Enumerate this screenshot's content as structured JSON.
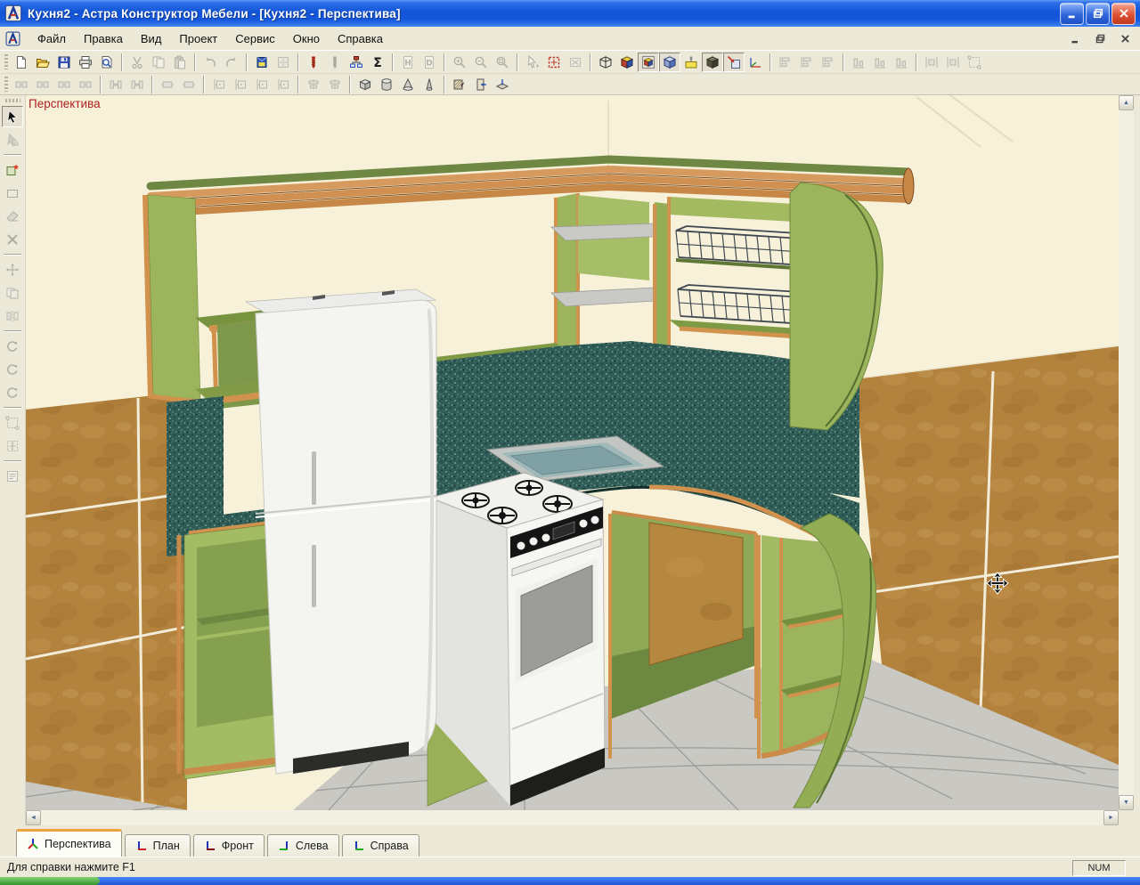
{
  "window": {
    "title": "Кухня2 - Астра Конструктор Мебели - [Кухня2 - Перспектива]",
    "controls": [
      "minimize",
      "restore",
      "close"
    ],
    "mdi_controls": [
      "minimize",
      "restore",
      "close"
    ]
  },
  "menu": {
    "items": [
      "Файл",
      "Правка",
      "Вид",
      "Проект",
      "Сервис",
      "Окно",
      "Справка"
    ]
  },
  "toolbar_main": {
    "groups": [
      {
        "buttons": [
          {
            "name": "new",
            "icon": "new",
            "enabled": true,
            "pressed": false
          },
          {
            "name": "open",
            "icon": "open",
            "enabled": true,
            "pressed": false
          },
          {
            "name": "save",
            "icon": "save",
            "enabled": true,
            "pressed": false
          },
          {
            "name": "print",
            "icon": "print",
            "enabled": true,
            "pressed": false
          },
          {
            "name": "print-preview",
            "icon": "preview",
            "enabled": true,
            "pressed": false
          }
        ]
      },
      {
        "buttons": [
          {
            "name": "cut",
            "icon": "cut",
            "enabled": false,
            "pressed": false
          },
          {
            "name": "copy",
            "icon": "copy",
            "enabled": false,
            "pressed": false
          },
          {
            "name": "paste",
            "icon": "paste",
            "enabled": false,
            "pressed": false
          }
        ]
      },
      {
        "buttons": [
          {
            "name": "undo",
            "icon": "undo",
            "enabled": false,
            "pressed": false
          },
          {
            "name": "redo",
            "icon": "redo",
            "enabled": false,
            "pressed": false
          }
        ]
      },
      {
        "buttons": [
          {
            "name": "materials",
            "icon": "material",
            "enabled": true,
            "pressed": false
          },
          {
            "name": "textures",
            "icon": "texture",
            "enabled": false,
            "pressed": false
          }
        ]
      },
      {
        "buttons": [
          {
            "name": "fasteners",
            "icon": "screw",
            "enabled": true,
            "pressed": false
          },
          {
            "name": "fasteners-auto",
            "icon": "screw",
            "enabled": false,
            "pressed": false
          },
          {
            "name": "structure",
            "icon": "tree",
            "enabled": true,
            "pressed": false
          },
          {
            "name": "calculate",
            "icon": "sigma",
            "enabled": true,
            "pressed": false
          }
        ]
      },
      {
        "buttons": [
          {
            "name": "spec-h",
            "icon": "doc-h",
            "enabled": false,
            "pressed": false
          },
          {
            "name": "spec-d",
            "icon": "doc-d",
            "enabled": false,
            "pressed": false
          }
        ]
      },
      {
        "buttons": [
          {
            "name": "zoom-in",
            "icon": "zoom-in",
            "enabled": false,
            "pressed": false
          },
          {
            "name": "zoom-out",
            "icon": "zoom-out",
            "enabled": false,
            "pressed": false
          },
          {
            "name": "zoom-extents",
            "icon": "zoom-ext",
            "enabled": false,
            "pressed": false
          }
        ]
      },
      {
        "buttons": [
          {
            "name": "zoom-window",
            "icon": "pointer-zoom",
            "enabled": false,
            "pressed": false
          },
          {
            "name": "zoom-selection",
            "icon": "fit-red",
            "enabled": true,
            "pressed": false
          },
          {
            "name": "erase-region",
            "icon": "xbox",
            "enabled": false,
            "pressed": false
          }
        ]
      },
      {
        "buttons": [
          {
            "name": "view-wireframe",
            "icon": "cube-wire",
            "enabled": true,
            "pressed": false
          },
          {
            "name": "view-shaded",
            "icon": "cube-solid",
            "enabled": true,
            "pressed": false
          },
          {
            "name": "view-edges",
            "icon": "cube-frame",
            "enabled": true,
            "pressed": true
          },
          {
            "name": "view-frame",
            "icon": "cube-blue",
            "enabled": true,
            "pressed": true
          },
          {
            "name": "view-fittings",
            "icon": "screw-box",
            "enabled": true,
            "pressed": false
          },
          {
            "name": "view-textured",
            "icon": "cube-dark",
            "enabled": true,
            "pressed": true
          },
          {
            "name": "move-object",
            "icon": "move-obj",
            "enabled": true,
            "pressed": true
          },
          {
            "name": "show-axes",
            "icon": "axes",
            "enabled": true,
            "pressed": false
          }
        ]
      },
      {
        "buttons": [
          {
            "name": "align-left",
            "icon": "align-h",
            "enabled": false,
            "pressed": false
          },
          {
            "name": "align-center-h",
            "icon": "align-h",
            "enabled": false,
            "pressed": false
          },
          {
            "name": "align-right",
            "icon": "align-h",
            "enabled": false,
            "pressed": false
          }
        ]
      },
      {
        "buttons": [
          {
            "name": "align-top",
            "icon": "align-v",
            "enabled": false,
            "pressed": false
          },
          {
            "name": "align-center-v",
            "icon": "align-v",
            "enabled": false,
            "pressed": false
          },
          {
            "name": "align-bottom",
            "icon": "align-v",
            "enabled": false,
            "pressed": false
          }
        ]
      },
      {
        "buttons": [
          {
            "name": "distribute-h",
            "icon": "distribute",
            "enabled": false,
            "pressed": false
          },
          {
            "name": "distribute-v",
            "icon": "distribute",
            "enabled": false,
            "pressed": false
          },
          {
            "name": "fit-frame",
            "icon": "selframe",
            "enabled": false,
            "pressed": false
          }
        ]
      }
    ]
  },
  "toolbar_second": {
    "groups": [
      {
        "buttons": [
          {
            "name": "bind-left",
            "icon": "bind",
            "enabled": false,
            "pressed": false
          },
          {
            "name": "bind-top",
            "icon": "bind",
            "enabled": false,
            "pressed": false
          },
          {
            "name": "bind-right",
            "icon": "bind",
            "enabled": false,
            "pressed": false
          },
          {
            "name": "bind-bottom",
            "icon": "bind",
            "enabled": false,
            "pressed": false
          }
        ]
      },
      {
        "buttons": [
          {
            "name": "gap-horizontal",
            "icon": "gap",
            "enabled": false,
            "pressed": false
          },
          {
            "name": "gap-vertical",
            "icon": "gap",
            "enabled": false,
            "pressed": false
          }
        ]
      },
      {
        "buttons": [
          {
            "name": "equal-width",
            "icon": "size",
            "enabled": false,
            "pressed": false
          },
          {
            "name": "equal-height",
            "icon": "size",
            "enabled": false,
            "pressed": false
          }
        ]
      },
      {
        "buttons": [
          {
            "name": "fasten-edge-1",
            "icon": "fasten",
            "enabled": false,
            "pressed": false
          },
          {
            "name": "fasten-edge-2",
            "icon": "fasten",
            "enabled": false,
            "pressed": false
          },
          {
            "name": "fasten-edge-3",
            "icon": "fasten",
            "enabled": false,
            "pressed": false
          },
          {
            "name": "fasten-edge-4",
            "icon": "fasten",
            "enabled": false,
            "pressed": false
          }
        ]
      },
      {
        "buttons": [
          {
            "name": "center-h",
            "icon": "centeralign",
            "enabled": false,
            "pressed": false
          },
          {
            "name": "center-v",
            "icon": "centeralign",
            "enabled": false,
            "pressed": false
          }
        ]
      },
      {
        "buttons": [
          {
            "name": "primitive-box",
            "icon": "prim-box",
            "enabled": true,
            "pressed": false
          },
          {
            "name": "primitive-cylinder",
            "icon": "prim-cyl",
            "enabled": true,
            "pressed": false
          },
          {
            "name": "primitive-cone",
            "icon": "prim-cone",
            "enabled": true,
            "pressed": false
          },
          {
            "name": "primitive-pyramid",
            "icon": "prim-pyr",
            "enabled": true,
            "pressed": false
          }
        ]
      },
      {
        "buttons": [
          {
            "name": "wall",
            "icon": "wall",
            "enabled": true,
            "pressed": false
          },
          {
            "name": "door",
            "icon": "door",
            "enabled": true,
            "pressed": false
          },
          {
            "name": "floor",
            "icon": "floor",
            "enabled": true,
            "pressed": false
          }
        ]
      }
    ]
  },
  "tool_palette": {
    "groups": [
      {
        "buttons": [
          {
            "name": "select",
            "icon": "arrow",
            "enabled": true,
            "pressed": true
          },
          {
            "name": "edit-points",
            "icon": "arrow-plus",
            "enabled": false,
            "pressed": false
          }
        ]
      },
      {
        "buttons": [
          {
            "name": "new-panel",
            "icon": "panel-new",
            "enabled": true,
            "pressed": false
          },
          {
            "name": "draw-rect",
            "icon": "rect",
            "enabled": false,
            "pressed": false
          },
          {
            "name": "erase",
            "icon": "eraser",
            "enabled": false,
            "pressed": false
          },
          {
            "name": "delete",
            "icon": "xdel",
            "enabled": false,
            "pressed": false
          }
        ]
      },
      {
        "buttons": [
          {
            "name": "move",
            "icon": "movetool",
            "enabled": false,
            "pressed": false
          },
          {
            "name": "copy-move",
            "icon": "shelfcopy",
            "enabled": false,
            "pressed": false
          },
          {
            "name": "mirror",
            "icon": "mirror",
            "enabled": false,
            "pressed": false
          }
        ]
      },
      {
        "buttons": [
          {
            "name": "rotate-x",
            "icon": "rotate",
            "enabled": false,
            "pressed": false
          },
          {
            "name": "rotate-y",
            "icon": "rotate",
            "enabled": false,
            "pressed": false
          },
          {
            "name": "rotate-z",
            "icon": "rotate",
            "enabled": false,
            "pressed": false
          }
        ]
      },
      {
        "buttons": [
          {
            "name": "select-frame",
            "icon": "selframe",
            "enabled": false,
            "pressed": false
          },
          {
            "name": "transform-frame",
            "icon": "selframe2",
            "enabled": false,
            "pressed": false
          }
        ]
      },
      {
        "buttons": [
          {
            "name": "properties",
            "icon": "props",
            "enabled": false,
            "pressed": false
          }
        ]
      }
    ]
  },
  "viewport": {
    "label": "Перспектива"
  },
  "view_tabs": [
    {
      "label": "Перспектива",
      "icon": "ax-persp",
      "active": true
    },
    {
      "label": "План",
      "icon": "ax-plan",
      "active": false
    },
    {
      "label": "Фронт",
      "icon": "ax-front",
      "active": false
    },
    {
      "label": "Слева",
      "icon": "ax-left",
      "active": false
    },
    {
      "label": "Справа",
      "icon": "ax-right",
      "active": false
    }
  ],
  "status_bar": {
    "message": "Для справки нажмите F1",
    "indicator": "NUM"
  },
  "scene": {
    "view": "perspective",
    "objects": [
      "plain-wall",
      "tiled-wall-left",
      "tiled-wall-right",
      "tiled-floor",
      "wall-cabinets-with-cornice",
      "open-shelves",
      "corner-shelf-unit",
      "wire-baskets",
      "granite-backsplash",
      "granite-countertop",
      "corner-sink",
      "refrigerator",
      "gas-stove",
      "corner-base-cabinet",
      "base-cabinets",
      "curved-side-panels"
    ],
    "colors": {
      "wall_cream": "#f6f1d8",
      "tile_brown": "#b3823d",
      "floor_grey": "#c9c8c3",
      "cabinet_green": "#a3bb62",
      "cabinet_green_dark": "#74903f",
      "wood_trim": "#d1924e",
      "granite_teal": "#2f5c56",
      "fridge_white": "#f4f4f1",
      "label_red": "#b11f1f",
      "titlebar_blue": "#1254d5",
      "tab_accent_orange": "#eda33c",
      "taskbar_blue": "#2a63d5",
      "start_green": "#3da33c"
    }
  }
}
